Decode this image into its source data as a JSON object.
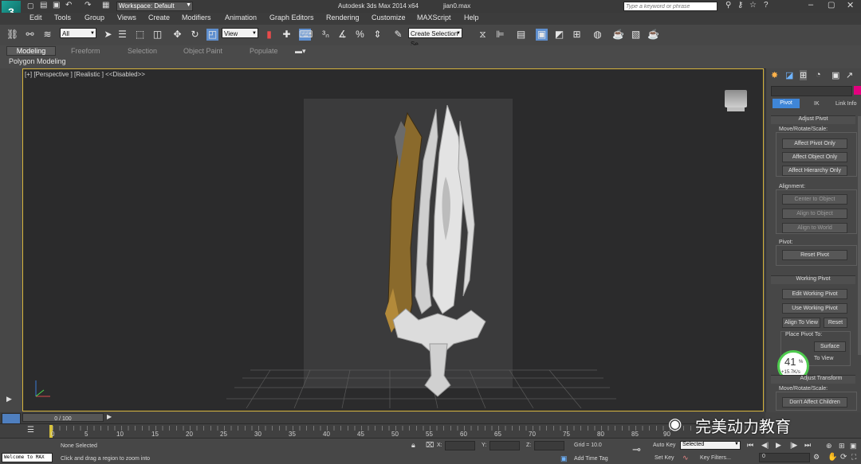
{
  "title_bar": {
    "workspace_label": "Workspace: Default",
    "app_title": "Autodesk 3ds Max  2014 x64",
    "file_name": "jian0.max",
    "search_placeholder": "Type a keyword or phrase"
  },
  "menu": [
    "Edit",
    "Tools",
    "Group",
    "Views",
    "Create",
    "Modifiers",
    "Animation",
    "Graph Editors",
    "Rendering",
    "Customize",
    "MAXScript",
    "Help"
  ],
  "toolbar": {
    "filter_select": "All",
    "refcoord_select": "View",
    "selection_set": "Create Selection Se"
  },
  "ribbon": {
    "tabs": [
      "Modeling",
      "Freeform",
      "Selection",
      "Object Paint",
      "Populate"
    ],
    "sub_label": "Polygon Modeling"
  },
  "viewport": {
    "label": "[+] [Perspective ] [Realistic ]  <<Disabled>>"
  },
  "command_panel": {
    "tabs": [
      "Pivot",
      "IK",
      "Link Info"
    ],
    "adjust_pivot": {
      "title": "Adjust Pivot",
      "move_rotate_scale": "Move/Rotate/Scale:",
      "buttons": [
        "Affect Pivot Only",
        "Affect Object Only",
        "Affect Hierarchy Only"
      ],
      "alignment": "Alignment:",
      "align_buttons": [
        "Center to Object",
        "Align to Object",
        "Align to World"
      ],
      "pivot_label": "Pivot:",
      "reset_pivot": "Reset Pivot"
    },
    "working_pivot": {
      "title": "Working Pivot",
      "edit_working_pivot": "Edit Working Pivot",
      "use_working_pivot": "Use Working Pivot",
      "align_to_view": "Align To View",
      "reset": "Reset",
      "place_pivot_to": "Place Pivot To:",
      "surface": "Surface",
      "to_view": "To View"
    },
    "adjust_transform": {
      "title": "Adjust Transform",
      "move_rotate_scale": "Move/Rotate/Scale:",
      "dont_affect_children": "Don't Affect Children"
    },
    "perf_widget": {
      "percent": "41",
      "percent_unit": "%",
      "rate": "+15.7K/s"
    }
  },
  "timeline": {
    "frame_display": "0 / 100",
    "ticks": [
      "0",
      "5",
      "10",
      "15",
      "20",
      "25",
      "30",
      "35",
      "40",
      "45",
      "50",
      "55",
      "60",
      "65",
      "70",
      "75",
      "80",
      "85",
      "90"
    ]
  },
  "status": {
    "listener": "Welcome to MAX",
    "none_selected": "None Selected",
    "prompt": "Click and drag a region to zoom into",
    "x_label": "X:",
    "y_label": "Y:",
    "z_label": "Z:",
    "grid": "Grid = 10.0",
    "add_time_tag": "Add Time Tag",
    "auto_key": "Auto Key",
    "set_key": "Set Key",
    "selected": "Selected",
    "key_filters": "Key Filters...",
    "frame": "0"
  },
  "watermark": "完美动力教育"
}
